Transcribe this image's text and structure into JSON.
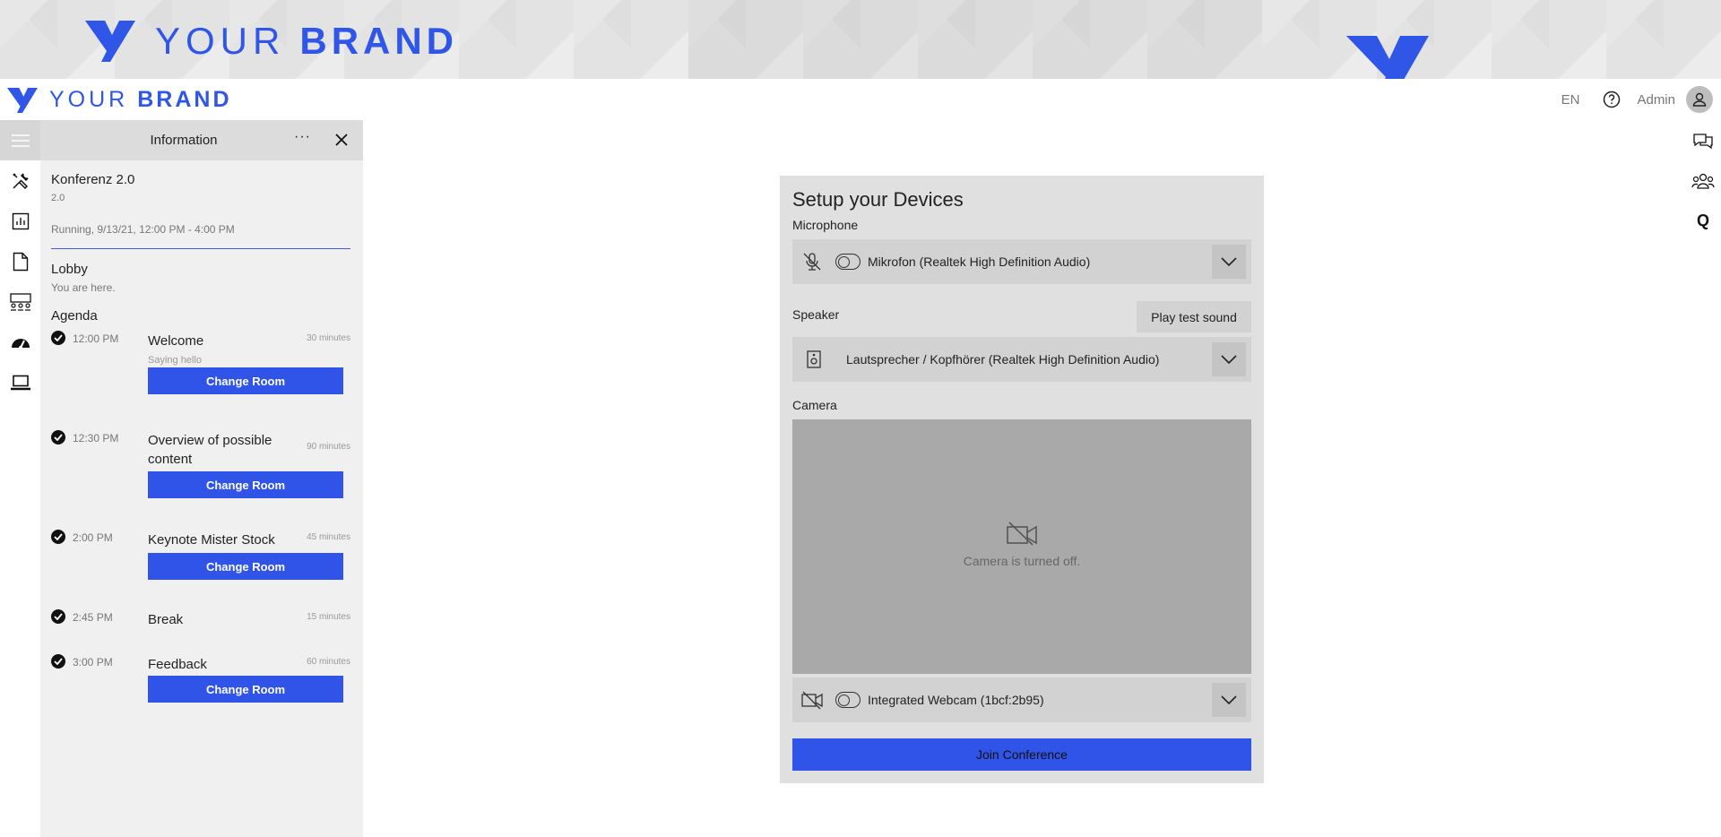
{
  "brand": {
    "word_light": "YOUR",
    "word_bold": "BRAND",
    "color": "#2f56e6"
  },
  "header": {
    "language": "EN",
    "user_name": "Admin",
    "icons": [
      "help-icon",
      "user-avatar-icon"
    ]
  },
  "left_rail": {
    "items": [
      "menu-icon",
      "tools-icon",
      "chart-icon",
      "document-icon",
      "rooms-icon",
      "dashboard-icon",
      "screen-icon"
    ]
  },
  "info_panel": {
    "title": "Information",
    "more": "···",
    "conference_name": "Konferenz 2.0",
    "conference_version": "2.0",
    "status": "Running, 9/13/21, 12:00 PM - 4:00 PM",
    "lobby_title": "Lobby",
    "lobby_subtitle": "You are here.",
    "agenda_title": "Agenda",
    "agenda": [
      {
        "time": "12:00 PM",
        "title": "Welcome",
        "duration": "30 minutes",
        "description": "Saying hello",
        "button": "Change Room"
      },
      {
        "time": "12:30 PM",
        "title": "Overview of possible content",
        "duration": "90 minutes",
        "description": "",
        "button": "Change Room"
      },
      {
        "time": "2:00 PM",
        "title": "Keynote Mister Stock",
        "duration": "45 minutes",
        "description": "",
        "button": "Change Room"
      },
      {
        "time": "2:45 PM",
        "title": "Break",
        "duration": "15 minutes",
        "description": "",
        "button": ""
      },
      {
        "time": "3:00 PM",
        "title": "Feedback",
        "duration": "60 minutes",
        "description": "",
        "button": "Change Room"
      }
    ]
  },
  "setup": {
    "title": "Setup your Devices",
    "microphone_label": "Microphone",
    "microphone_device": "Mikrofon (Realtek High Definition Audio)",
    "speaker_label": "Speaker",
    "play_test_sound": "Play test sound",
    "speaker_device": "Lautsprecher / Kopfhörer (Realtek High Definition Audio)",
    "camera_label": "Camera",
    "camera_off_text": "Camera is turned off.",
    "camera_device": "Integrated Webcam (1bcf:2b95)",
    "join_button": "Join Conference",
    "accent": "#3054e8"
  },
  "right_rail": {
    "items": [
      "chat-icon",
      "participants-icon",
      "q-icon"
    ],
    "q_label": "Q"
  }
}
